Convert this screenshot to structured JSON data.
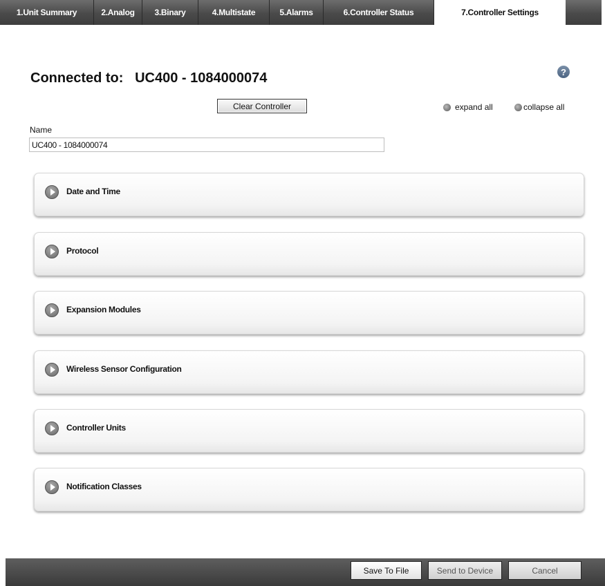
{
  "tabs": [
    {
      "label": "1.Unit Summary"
    },
    {
      "label": "2.Analog"
    },
    {
      "label": "3.Binary"
    },
    {
      "label": "4.Multistate"
    },
    {
      "label": "5.Alarms"
    },
    {
      "label": "6.Controller Status"
    },
    {
      "label": "7.Controller Settings",
      "active": true
    }
  ],
  "header": {
    "connected_label": "Connected to:   UC400 - 1084000074",
    "help_icon": "question-circle-icon"
  },
  "toolbar": {
    "clear_label": "Clear Controller",
    "expand_label": "expand all",
    "collapse_label": "collapse all"
  },
  "name_field": {
    "label": "Name",
    "value": "UC400 - 1084000074"
  },
  "sections": [
    {
      "label": "Date and Time"
    },
    {
      "label": "Protocol"
    },
    {
      "label": "Expansion Modules"
    },
    {
      "label": "Wireless Sensor Configuration"
    },
    {
      "label": "Controller Units"
    },
    {
      "label": "Notification Classes"
    }
  ],
  "footer": {
    "save_label": "Save To File",
    "send_label": "Send to Device",
    "cancel_label": "Cancel"
  }
}
